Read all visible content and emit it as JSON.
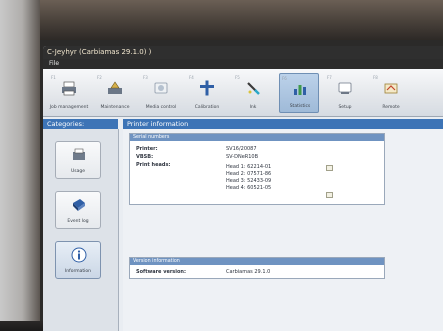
{
  "window": {
    "title": "C-Jeyhyr (Carbiamas 29.1.0) )",
    "menu": "File"
  },
  "toolbar": {
    "items": [
      {
        "fn": "F1",
        "label": "Job management",
        "icon": "printer-icon",
        "active": false
      },
      {
        "fn": "F2",
        "label": "Maintenance",
        "icon": "maintenance-icon",
        "active": false
      },
      {
        "fn": "F3",
        "label": "Media control",
        "icon": "media-icon",
        "active": false
      },
      {
        "fn": "F4",
        "label": "Calibration",
        "icon": "calibration-icon",
        "active": false
      },
      {
        "fn": "F5",
        "label": "Ink",
        "icon": "ink-icon",
        "active": false
      },
      {
        "fn": "F6",
        "label": "Statistics",
        "icon": "statistics-icon",
        "active": true
      },
      {
        "fn": "F7",
        "label": "Setup",
        "icon": "setup-icon",
        "active": false
      },
      {
        "fn": "F8",
        "label": "Remote",
        "icon": "remote-icon",
        "active": false
      }
    ]
  },
  "categories": {
    "header": "Categories:",
    "items": [
      {
        "label": "Usage",
        "icon": "usage-icon",
        "active": false
      },
      {
        "label": "Event log",
        "icon": "event-log-icon",
        "active": false
      },
      {
        "label": "Information",
        "icon": "information-icon",
        "active": true
      }
    ]
  },
  "main": {
    "header": "Printer information",
    "serial": {
      "title": "Serial numbers",
      "printer_label": "Printer:",
      "printer_value": "SV16/20087",
      "vbsb_label": "VBSB:",
      "vbsb_value": "SV-DNeR10B",
      "heads_label": "Print heads:",
      "heads": [
        "Head 1: 62214-01",
        "Head 2: 07571-86",
        "Head 3: 52433-09",
        "Head 4: 60521-05"
      ]
    },
    "version": {
      "title": "Version information",
      "software_label": "Software version:",
      "software_value": "Carbiamas 29.1.0"
    }
  },
  "colors": {
    "accent": "#3d74b6",
    "group_header": "#6f93c1",
    "titlebar": "#2f2f2f"
  }
}
